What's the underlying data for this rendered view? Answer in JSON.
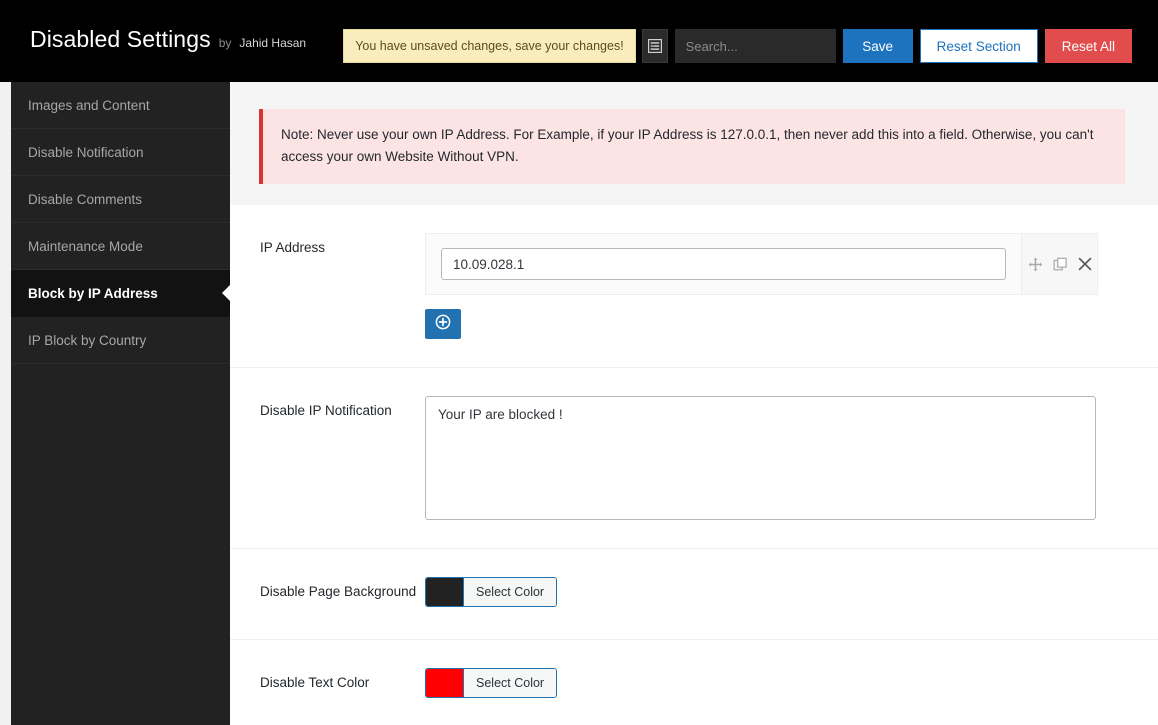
{
  "header": {
    "title": "Disabled Settings",
    "by_label": "by",
    "author": "Jahid Hasan",
    "unsaved_notice": "You have unsaved changes, save your changes!",
    "collapse_icon": "collapse-sections-icon",
    "search_placeholder": "Search...",
    "search_value": "",
    "save_label": "Save",
    "reset_section_label": "Reset Section",
    "reset_all_label": "Reset All",
    "colors": {
      "bar_background": "#000000",
      "save_blue": "#1e73be",
      "reset_all_red": "#e14d4d",
      "unsaved_background": "#f9edbe"
    }
  },
  "sidebar": {
    "items": [
      {
        "label": "Images and Content",
        "active": false
      },
      {
        "label": "Disable Notification",
        "active": false
      },
      {
        "label": "Disable Comments",
        "active": false
      },
      {
        "label": "Maintenance Mode",
        "active": false
      },
      {
        "label": "Block by IP Address",
        "active": true
      },
      {
        "label": "IP Block by Country",
        "active": false
      }
    ],
    "background": "#222222",
    "active_background": "#121212"
  },
  "notice": {
    "text": "Note: Never use your own IP Address. For Example, if your IP Address is 127.0.0.1, then never add this into a field. Otherwise, you can't access your own Website Without VPN.",
    "accent_color": "#dc3232",
    "background": "#fce4e4"
  },
  "fields": {
    "ip_address": {
      "label": "IP Address",
      "value": "10.09.028.1",
      "placeholder": "",
      "move_icon": "move-icon",
      "clone_icon": "clone-icon",
      "remove_icon": "close-icon",
      "add_icon": "plus-circle-icon"
    },
    "ip_notification": {
      "label": "Disable IP Notification",
      "value": "Your IP are blocked !",
      "placeholder": ""
    },
    "page_background": {
      "label": "Disable Page Background",
      "button_label": "Select Color",
      "color": "#222222"
    },
    "text_color": {
      "label": "Disable Text Color",
      "button_label": "Select Color",
      "color": "#ff0000"
    }
  }
}
